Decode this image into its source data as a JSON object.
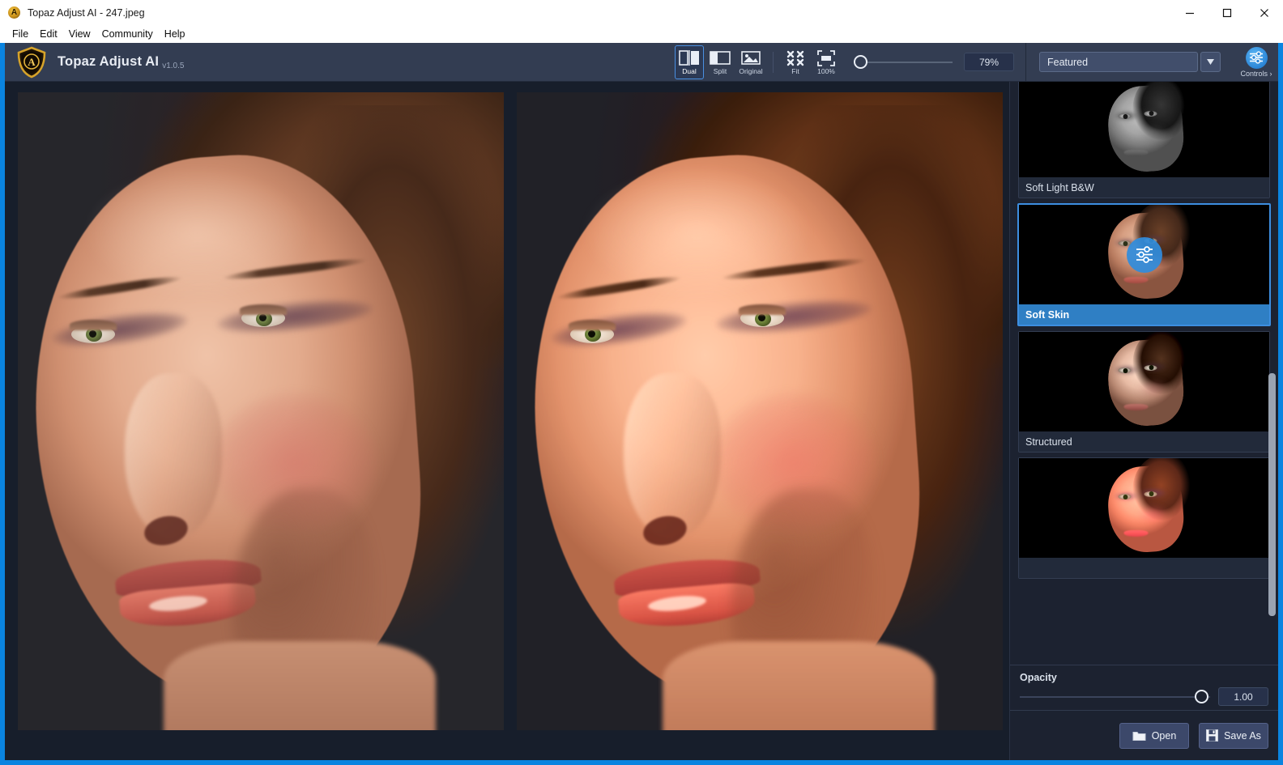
{
  "window": {
    "title": "Topaz Adjust AI  -  247.jpeg",
    "logo_icon": "topaz-shield-icon",
    "minimize_icon": "minimize-icon",
    "maximize_icon": "maximize-icon",
    "close_icon": "close-icon"
  },
  "menubar": {
    "items": [
      {
        "label": "File"
      },
      {
        "label": "Edit"
      },
      {
        "label": "View"
      },
      {
        "label": "Community"
      },
      {
        "label": "Help"
      }
    ]
  },
  "brand": {
    "shield_icon": "topaz-shield-icon",
    "name": "Topaz Adjust AI",
    "version": "v1.0.5"
  },
  "toolbar": {
    "view_modes": [
      {
        "label": "Dual",
        "icon": "dual-view-icon",
        "active": true
      },
      {
        "label": "Split",
        "icon": "split-view-icon",
        "active": false
      },
      {
        "label": "Original",
        "icon": "original-image-icon",
        "active": false
      }
    ],
    "zoom_modes": [
      {
        "label": "Fit",
        "icon": "fit-to-window-icon"
      },
      {
        "label": "100%",
        "icon": "zoom-100-icon"
      }
    ],
    "zoom_slider": {
      "value": 0,
      "icon": "slider-knob-icon"
    },
    "zoom_value": "79%"
  },
  "preset_picker": {
    "selected": "Featured",
    "dropdown_icon": "chevron-down-icon",
    "controls": {
      "label": "Controls ›",
      "icon": "sliders-icon"
    }
  },
  "presets": [
    {
      "label": "Soft Light B&W",
      "style": "bw",
      "selected": false,
      "overlay_icon": null
    },
    {
      "label": "Soft Skin",
      "style": "soft",
      "selected": true,
      "overlay_icon": "sliders-icon"
    },
    {
      "label": "Structured",
      "style": "structured",
      "selected": false,
      "overlay_icon": null
    },
    {
      "label": "",
      "style": "warm",
      "selected": false,
      "overlay_icon": null
    }
  ],
  "opacity": {
    "label": "Opacity",
    "value": "1.00",
    "knob_icon": "slider-knob-icon"
  },
  "actions": {
    "open": {
      "label": "Open",
      "icon": "folder-icon"
    },
    "save_as": {
      "label": "Save As",
      "icon": "floppy-disk-icon"
    }
  },
  "image_panes": {
    "left": {
      "name": "original-preview"
    },
    "right": {
      "name": "processed-preview"
    }
  },
  "colors": {
    "window_border": "#0a84e0",
    "toolbar_bg": "#333d52",
    "panel_bg": "#1c2230",
    "accent": "#3d8ee0",
    "selected_label_bg": "#2f7fc4"
  }
}
